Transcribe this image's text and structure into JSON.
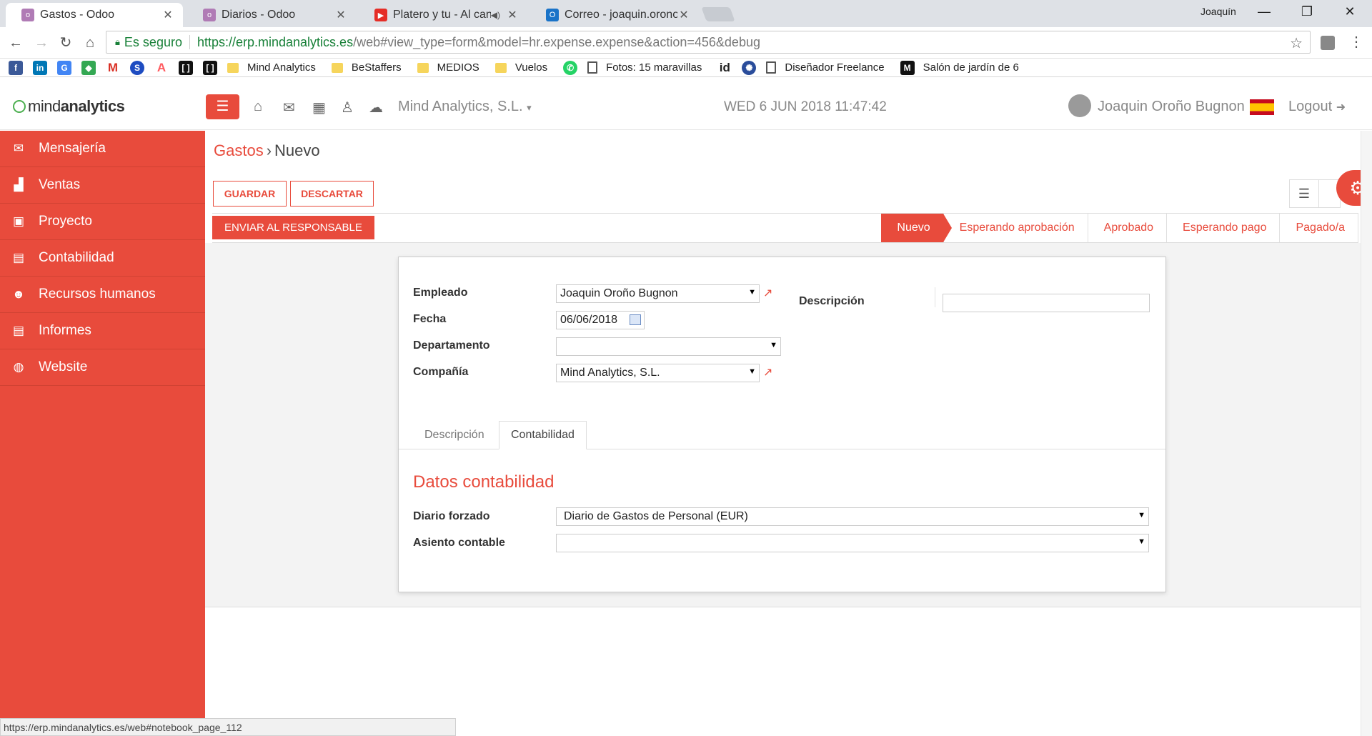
{
  "browser": {
    "tabs": [
      {
        "title": "Gastos - Odoo",
        "active": true
      },
      {
        "title": "Diarios - Odoo",
        "active": false
      },
      {
        "title": "Platero y tu - Al canta",
        "active": false
      },
      {
        "title": "Correo - joaquin.orono@",
        "active": false
      }
    ],
    "window_user": "Joaquín",
    "secure_label": "Es seguro",
    "url_host": "https://erp.mindanalytics.es",
    "url_rest": "/web#view_type=form&model=hr.expense.expense&action=456&debug",
    "bookmarks": [
      "Mind Analytics",
      "BeStaffers",
      "MEDIOS",
      "Vuelos",
      "Fotos: 15 maravillas",
      "Diseñador Freelance",
      "Salón de jardín de 6"
    ],
    "status_url": "https://erp.mindanalytics.es/web#notebook_page_112"
  },
  "app": {
    "logo_light": "mind",
    "logo_bold": "analytics",
    "company": "Mind Analytics, S.L.",
    "datetime": "WED 6 JUN 2018 11:47:42",
    "user": "Joaquin Oroño Bugnon",
    "logout": "Logout",
    "accent": "#e84b3c"
  },
  "sidebar": {
    "items": [
      {
        "label": "Mensajería",
        "icon": "envelope-icon"
      },
      {
        "label": "Ventas",
        "icon": "bar-chart-icon"
      },
      {
        "label": "Proyecto",
        "icon": "trello-icon"
      },
      {
        "label": "Contabilidad",
        "icon": "document-icon"
      },
      {
        "label": "Recursos humanos",
        "icon": "users-icon"
      },
      {
        "label": "Informes",
        "icon": "report-icon"
      },
      {
        "label": "Website",
        "icon": "globe-icon"
      }
    ]
  },
  "page": {
    "breadcrumb_parent": "Gastos",
    "breadcrumb_current": "Nuevo",
    "save_label": "GUARDAR",
    "discard_label": "DESCARTAR",
    "submit_label": "ENVIAR AL RESPONSABLE",
    "stages": [
      "Nuevo",
      "Esperando aprobación",
      "Aprobado",
      "Esperando pago",
      "Pagado/a"
    ],
    "active_stage": "Nuevo"
  },
  "form": {
    "employee_label": "Empleado",
    "employee_value": "Joaquin Oroño Bugnon",
    "date_label": "Fecha",
    "date_value": "06/06/2018",
    "department_label": "Departamento",
    "department_value": "",
    "company_label": "Compañía",
    "company_value": "Mind Analytics, S.L.",
    "description_label": "Descripción",
    "description_value": "",
    "tabs": [
      "Descripción",
      "Contabilidad"
    ],
    "active_tab": "Contabilidad",
    "section_title": "Datos contabilidad",
    "journal_label": "Diario forzado",
    "journal_value": "Diario de Gastos de Personal (EUR)",
    "move_label": "Asiento contable",
    "move_value": ""
  }
}
